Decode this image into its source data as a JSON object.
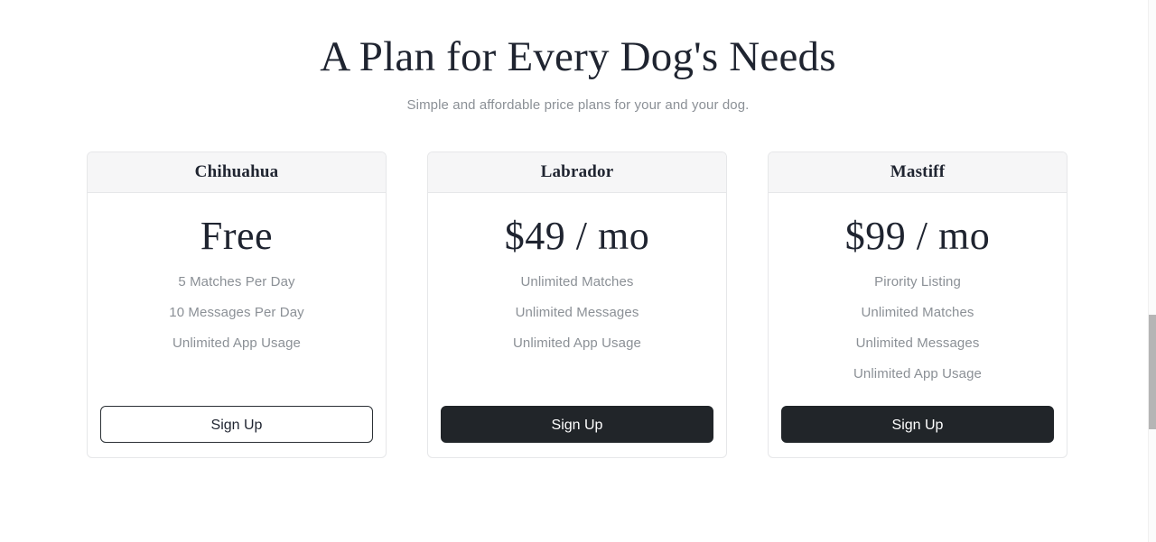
{
  "header": {
    "title": "A Plan for Every Dog's Needs",
    "subtitle": "Simple and affordable price plans for your and your dog."
  },
  "colors": {
    "page_background": "#ffffff",
    "text_dark": "#1f2430",
    "text_muted": "#8b9096",
    "card_border": "#e6e7e9",
    "card_header_background": "#f6f6f7",
    "button_solid_background": "#212529",
    "button_solid_text": "#ffffff",
    "button_outline_border": "#2b3035",
    "scrollbar_thumb": "#b5b5b5"
  },
  "plans": [
    {
      "name": "Chihuahua",
      "price": "Free",
      "features": [
        "5 Matches Per Day",
        "10 Messages Per Day",
        "Unlimited App Usage"
      ],
      "cta_label": "Sign Up",
      "cta_style": "outline"
    },
    {
      "name": "Labrador",
      "price": "$49 / mo",
      "features": [
        "Unlimited Matches",
        "Unlimited Messages",
        "Unlimited App Usage"
      ],
      "cta_label": "Sign Up",
      "cta_style": "solid"
    },
    {
      "name": "Mastiff",
      "price": "$99 / mo",
      "features": [
        "Pirority Listing",
        "Unlimited Matches",
        "Unlimited Messages",
        "Unlimited App Usage"
      ],
      "cta_label": "Sign Up",
      "cta_style": "solid"
    }
  ]
}
